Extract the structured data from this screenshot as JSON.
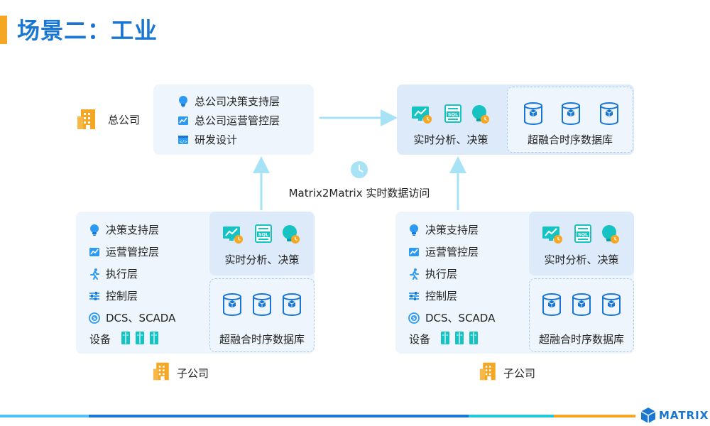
{
  "page": {
    "title": "场景二：工业"
  },
  "hq": {
    "label": "总公司",
    "layers": [
      {
        "label": "总公司决策支持层",
        "icon": "bulb-icon"
      },
      {
        "label": "总公司运营管控层",
        "icon": "trend-chart-icon"
      },
      {
        "label": "研发设计",
        "icon": "code-window-icon"
      }
    ],
    "analysis_label": "实时分析、决策",
    "db_label": "超融合时序数据库"
  },
  "sync": {
    "label": "Matrix2Matrix 实时数据访问",
    "icon": "clock-icon"
  },
  "subsidiaries": [
    {
      "label": "子公司",
      "layers": [
        {
          "label": "决策支持层",
          "icon": "bulb-icon"
        },
        {
          "label": "运营管控层",
          "icon": "trend-chart-icon"
        },
        {
          "label": "执行层",
          "icon": "runner-icon"
        },
        {
          "label": "控制层",
          "icon": "sliders-icon"
        },
        {
          "label": "DCS、SCADA",
          "icon": "scada-icon"
        }
      ],
      "device_label": "设备",
      "analysis_label": "实时分析、决策",
      "db_label": "超融合时序数据库"
    },
    {
      "label": "子公司",
      "layers": [
        {
          "label": "决策支持层",
          "icon": "bulb-icon"
        },
        {
          "label": "运营管控层",
          "icon": "trend-chart-icon"
        },
        {
          "label": "执行层",
          "icon": "runner-icon"
        },
        {
          "label": "控制层",
          "icon": "sliders-icon"
        },
        {
          "label": "DCS、SCADA",
          "icon": "scada-icon"
        }
      ],
      "device_label": "设备",
      "analysis_label": "实时分析、决策",
      "db_label": "超融合时序数据库"
    }
  ],
  "brand": {
    "name": "MATRIX"
  },
  "colors": {
    "primary": "#1976D2",
    "accent": "#F5A623",
    "teal": "#17C2C2",
    "light_box": "#EEF5FD",
    "arrow": "#A7E3F4"
  }
}
